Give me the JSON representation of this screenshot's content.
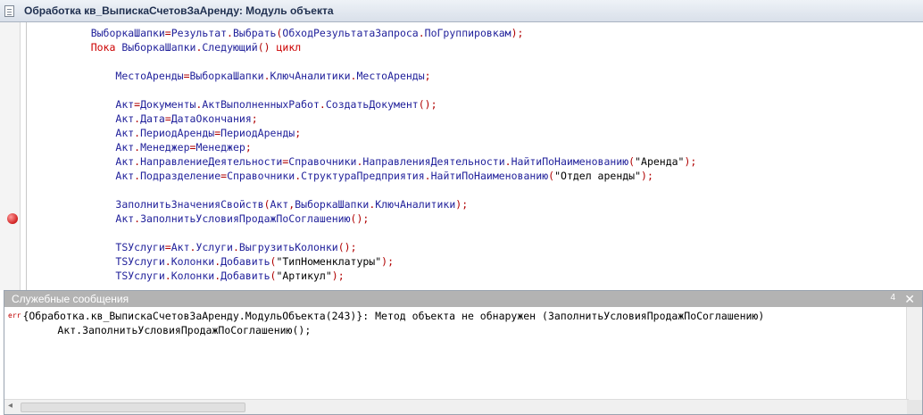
{
  "window": {
    "title": "Обработка кв_ВыпискаСчетовЗаАренду: Модуль объекта"
  },
  "editor": {
    "lines": [
      "    ВыборкаШапки=Результат.Выбрать(ОбходРезультатаЗапроса.ПоГруппировкам);",
      "    Пока ВыборкаШапки.Следующий() цикл",
      "",
      "        МестоАренды=ВыборкаШапки.КлючАналитики.МестоАренды;",
      "",
      "        Акт=Документы.АктВыполненныхРабот.СоздатьДокумент();",
      "        Акт.Дата=ДатаОкончания;",
      "        Акт.ПериодАренды=ПериодАренды;",
      "        Акт.Менеджер=Менеджер;",
      "        Акт.НаправлениеДеятельности=Справочники.НаправленияДеятельности.НайтиПоНаименованию(\"Аренда\");",
      "        Акт.Подразделение=Справочники.СтруктураПредприятия.НайтиПоНаименованию(\"Отдел аренды\");",
      "",
      "        ЗаполнитьЗначенияСвойств(Акт,ВыборкаШапки.КлючАналитики);",
      "        Акт.ЗаполнитьУсловияПродажПоСоглашению();",
      "",
      "        TSУслуги=Акт.Услуги.ВыгрузитьКолонки();",
      "        TSУслуги.Колонки.Добавить(\"ТипНоменклатуры\");",
      "        TSУслуги.Колонки.Добавить(\"Артикул\");"
    ],
    "breakpoint_line": 13
  },
  "messages": {
    "title": "Служебные сообщения",
    "pin_label": "4",
    "close_label": "✕",
    "err_tag": "err",
    "lines": [
      "{Обработка.кв_ВыпискаСчетовЗаАренду.МодульОбъекта(243)}: Метод объекта не обнаружен (ЗаполнитьУсловияПродажПоСоглашению)",
      "        Акт.ЗаполнитьУсловияПродажПоСоглашению();"
    ]
  }
}
